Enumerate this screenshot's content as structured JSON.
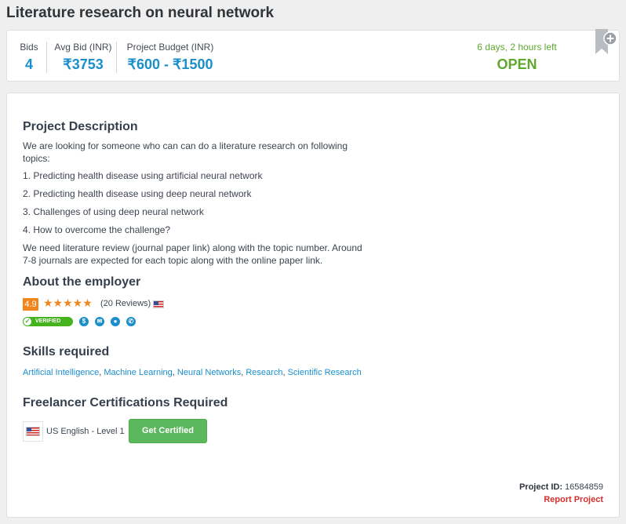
{
  "title": "Literature research on neural network",
  "stats": {
    "bids_label": "Bids",
    "bids_value": "4",
    "avg_bid_label": "Avg Bid (INR)",
    "avg_bid_value": "₹3753",
    "budget_label": "Project Budget (INR)",
    "budget_value": "₹600 - ₹1500",
    "time_left": "6 days, 2 hours left",
    "status": "OPEN"
  },
  "description": {
    "heading": "Project Description",
    "intro": "We are looking for someone who can can do a literature research on following topics:",
    "items": [
      "1. Predicting health disease using artificial neural network",
      "2. Predicting health disease using deep neural network",
      "3. Challenges of using deep neural network",
      "4. How to overcome the challenge?"
    ],
    "closing": "We need literature review (journal paper link) along with the topic number. Around 7-8 journals are expected for each topic along with the online paper link."
  },
  "employer": {
    "heading": "About the employer",
    "rating": "4.9",
    "stars": "★★★★★",
    "reviews": "(20 Reviews)",
    "verified_label": "VERIFIED"
  },
  "skills": {
    "heading": "Skills required",
    "items": [
      "Artificial Intelligence",
      "Machine Learning",
      "Neural Networks",
      "Research",
      "Scientific Research"
    ]
  },
  "certifications": {
    "heading": "Freelancer Certifications Required",
    "cert_label": "US English - Level 1",
    "button_label": "Get Certified"
  },
  "footer": {
    "project_id_label": "Project ID:",
    "project_id_value": "16584859",
    "report_label": "Report Project"
  },
  "colors": {
    "accent_blue": "#1a8fcb",
    "open_green": "#5ea82e",
    "rating_orange": "#f0861c",
    "button_green": "#5cb85c",
    "report_red": "#d32f2f"
  }
}
